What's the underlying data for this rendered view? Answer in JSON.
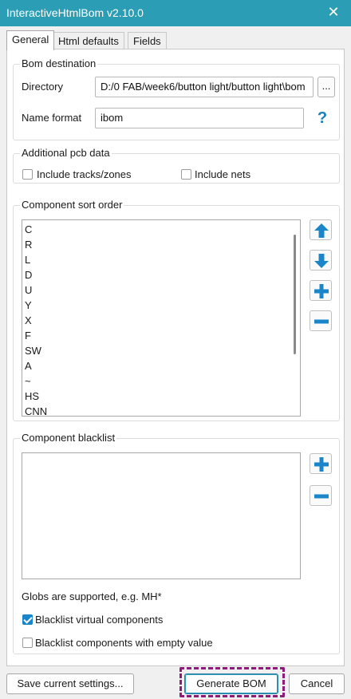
{
  "window": {
    "title": "InteractiveHtmlBom v2.10.0",
    "close_glyph": "✕"
  },
  "tabs": [
    {
      "label": "General",
      "active": true
    },
    {
      "label": "Html defaults",
      "active": false
    },
    {
      "label": "Fields",
      "active": false
    }
  ],
  "bom_destination": {
    "group_title": "Bom destination",
    "directory_label": "Directory",
    "directory_value": "D:/0 FAB/week6/button light/button light\\bom",
    "browse_label": "...",
    "name_format_label": "Name format",
    "name_format_value": "ibom",
    "help_label": "?"
  },
  "additional_pcb": {
    "group_title": "Additional pcb data",
    "include_tracks_label": "Include tracks/zones",
    "include_tracks_checked": false,
    "include_nets_label": "Include nets",
    "include_nets_checked": false
  },
  "sort_order": {
    "group_title": "Component sort order",
    "items": [
      "C",
      "R",
      "L",
      "D",
      "U",
      "Y",
      "X",
      "F",
      "SW",
      "A",
      "~",
      "HS",
      "CNN"
    ],
    "buttons": [
      "arrow-up-icon",
      "arrow-down-icon",
      "plus-icon",
      "minus-icon"
    ]
  },
  "blacklist": {
    "group_title": "Component blacklist",
    "items": [],
    "globs_hint": "Globs are supported, e.g. MH*",
    "blacklist_virtual_label": "Blacklist virtual components",
    "blacklist_virtual_checked": true,
    "blacklist_empty_label": "Blacklist components with empty value",
    "blacklist_empty_checked": false
  },
  "footer": {
    "save_label": "Save current settings...",
    "generate_label": "Generate BOM",
    "cancel_label": "Cancel"
  },
  "colors": {
    "titlebar": "#2b9db4",
    "icon_blue": "#1a85c8",
    "highlight": "#8e1a7a"
  }
}
